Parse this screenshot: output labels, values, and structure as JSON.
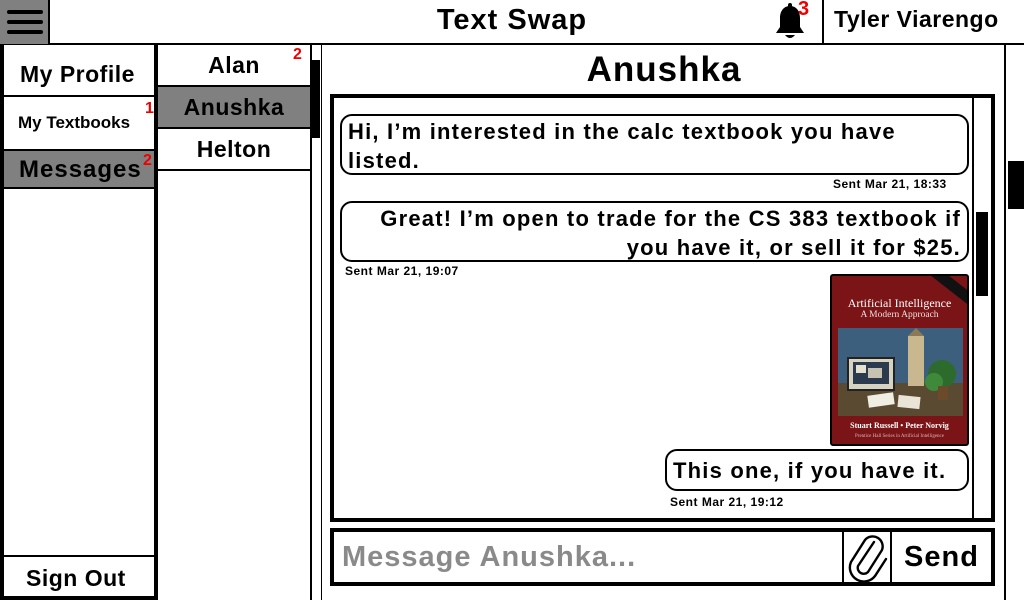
{
  "header": {
    "menu_icon": "hamburger-menu-icon",
    "title": "Text Swap",
    "notification_icon": "bell-icon",
    "notification_count": "3",
    "user_name": "Tyler Viarengo"
  },
  "nav": {
    "items": [
      {
        "label": "My Profile",
        "badge": ""
      },
      {
        "label": "My Textbooks",
        "badge": "1"
      },
      {
        "label": "Messages",
        "badge": "2",
        "active": true
      }
    ],
    "sign_out": "Sign Out"
  },
  "contacts": {
    "items": [
      {
        "name": "Alan",
        "badge": "2"
      },
      {
        "name": "Anushka",
        "badge": "",
        "active": true
      },
      {
        "name": "Helton",
        "badge": ""
      }
    ]
  },
  "conversation": {
    "title": "Anushka",
    "messages": [
      {
        "text": "Hi, I’m interested in the calc textbook you have listed.",
        "timestamp": "Sent Mar 21, 18:33",
        "side": "right"
      },
      {
        "text": "Great! I’m open to trade for the CS 383 textbook if you have it, or sell it for $25.",
        "timestamp": "Sent Mar 21, 19:07",
        "side": "left"
      },
      {
        "text": "This one, if you have it.",
        "timestamp": "Sent Mar 21, 19:12",
        "side": "right",
        "attachment": {
          "type": "book-cover-image",
          "title": "Artificial Intelligence",
          "subtitle": "A Modern Approach",
          "authors": "Stuart Russell • Peter Norvig",
          "series": "Prentice Hall Series in Artificial Intelligence",
          "cover_color": "#7a1416"
        }
      }
    ]
  },
  "composer": {
    "placeholder": "Message Anushka...",
    "attach_icon": "paperclip-icon",
    "send_label": "Send"
  },
  "colors": {
    "active_item": "#808080",
    "badge": "#e00000",
    "border": "#000000"
  }
}
